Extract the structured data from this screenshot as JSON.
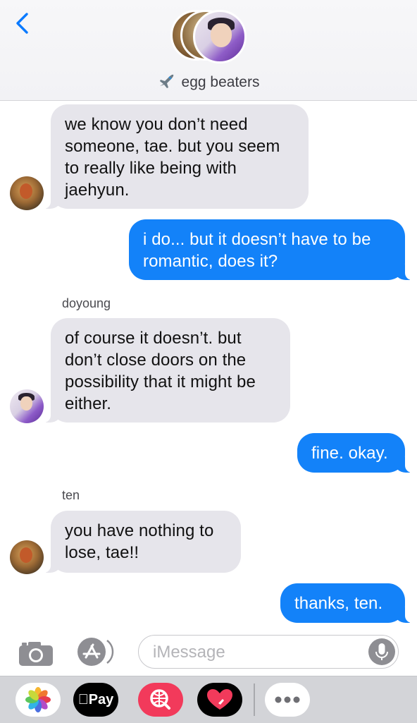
{
  "header": {
    "back_icon": "chevron-left-icon",
    "group_emoji": "airplane-emoji",
    "group_name": "egg beaters"
  },
  "messages": [
    {
      "direction": "incoming",
      "sender_avatar": "ten",
      "text_lines": [
        "we know you don’t need",
        "someone, tae. but you seem",
        "to really like being with",
        "jaehyun."
      ]
    },
    {
      "direction": "outgoing",
      "text_lines": [
        "i do... but it doesn’t have to be",
        "romantic, does it?"
      ]
    },
    {
      "direction": "incoming",
      "sender": "doyoung",
      "sender_avatar": "doyoung",
      "text_lines": [
        "of course it doesn’t. but",
        "don’t close doors on the",
        "possibility that it might be",
        "either."
      ]
    },
    {
      "direction": "outgoing",
      "text_lines": [
        "fine. okay."
      ]
    },
    {
      "direction": "incoming",
      "sender": "ten",
      "sender_avatar": "ten",
      "text_lines": [
        "you have nothing to",
        "lose, tae!!"
      ]
    },
    {
      "direction": "outgoing",
      "text_lines": [
        "thanks, ten."
      ]
    }
  ],
  "input_bar": {
    "camera_icon": "camera-icon",
    "appstore_icon": "app-store-icon",
    "placeholder": "iMessage",
    "mic_icon": "microphone-icon"
  },
  "app_drawer": {
    "apps": [
      "photos-icon",
      "apple-pay-icon",
      "image-search-icon",
      "digital-touch-icon",
      "more-icon"
    ],
    "pay_label": "Pay"
  },
  "colors": {
    "outgoing_bubble": "#1382f9",
    "incoming_bubble": "#e6e5eb",
    "accent": "#007aff"
  }
}
